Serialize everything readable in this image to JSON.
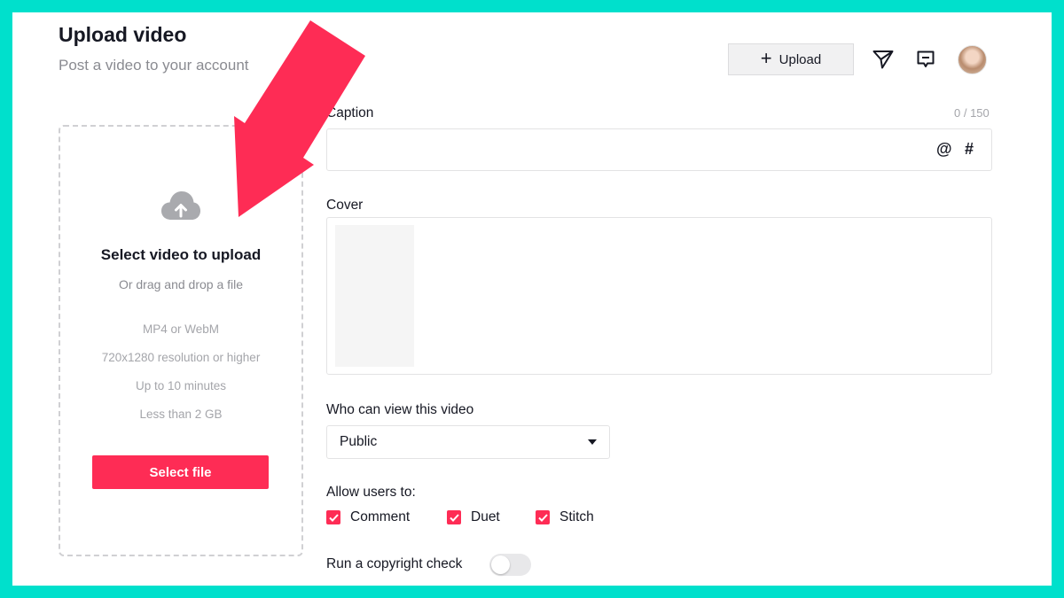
{
  "header": {
    "title": "Upload video",
    "subtitle": "Post a video to your account",
    "upload_button_label": "Upload",
    "icons": [
      "plus-icon",
      "send-icon",
      "inbox-icon"
    ]
  },
  "dropzone": {
    "icon": "cloud-upload-icon",
    "title": "Select video to upload",
    "subtitle": "Or drag and drop a file",
    "requirements": [
      "MP4 or WebM",
      "720x1280 resolution or higher",
      "Up to 10 minutes",
      "Less than 2 GB"
    ],
    "select_button_label": "Select file"
  },
  "form": {
    "caption_label": "Caption",
    "caption_count": "0 / 150",
    "caption_value": "",
    "mention_symbol": "@",
    "hashtag_symbol": "#",
    "cover_label": "Cover",
    "privacy_label": "Who can view this video",
    "privacy_value": "Public",
    "allow_label": "Allow users to:",
    "allow_options": [
      {
        "label": "Comment",
        "checked": true
      },
      {
        "label": "Duet",
        "checked": true
      },
      {
        "label": "Stitch",
        "checked": true
      }
    ],
    "copyright_label": "Run a copyright check",
    "copyright_enabled": false
  },
  "colors": {
    "accent": "#fe2c55",
    "frame_border": "#00e0cc",
    "annotation_arrow": "#fe2c55"
  }
}
